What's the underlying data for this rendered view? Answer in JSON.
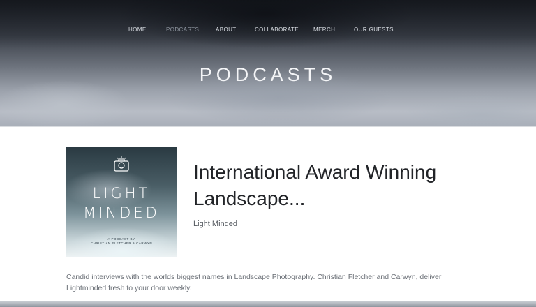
{
  "nav": {
    "items": [
      {
        "label": "HOME",
        "active": false
      },
      {
        "label": "PODCASTS",
        "active": true
      },
      {
        "label": "ABOUT",
        "active": false
      },
      {
        "label": "COLLABORATE",
        "active": false
      },
      {
        "label": "MERCH",
        "active": false
      },
      {
        "label": "OUR GUESTS",
        "active": false
      }
    ]
  },
  "hero": {
    "title": "PODCASTS"
  },
  "podcast": {
    "cover": {
      "title_line1": "LIGHT",
      "title_line2": "MINDED",
      "subtitle_line1": "A PODCAST BY",
      "subtitle_line2": "CHRISTIAN FLETCHER & CARWYN",
      "icon": "camera-lightbulb-icon"
    },
    "title": "International Award Winning Landscape...",
    "author": "Light Minded",
    "description": "Candid interviews with the worlds biggest names in Landscape Photography. Christian Fletcher and Carwyn, deliver Lightminded fresh to your door weekly."
  },
  "colors": {
    "nav_text": "#d9dde3",
    "nav_active": "#8f96a0",
    "title_text": "#222428"
  }
}
